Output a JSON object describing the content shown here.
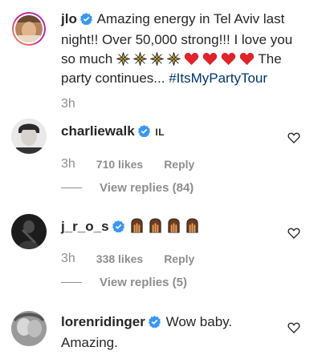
{
  "caption": {
    "username": "jlo",
    "text_line1": "Amazing energy in Tel Aviv last",
    "text_line2": "night!! Over 50,000 strong!!! I love you",
    "text_line3_prefix": "so much",
    "text_line3_suffix": "The",
    "text_line4": "party continues...",
    "hashtag": "#ItsMyPartyTour",
    "time": "3h",
    "emojis": [
      "sparkle-star",
      "sparkle-star",
      "sparkle-star",
      "sparkle-star",
      "red-heart",
      "red-heart",
      "red-heart",
      "red-heart"
    ]
  },
  "comments": [
    {
      "username": "charliewalk",
      "text": "IL",
      "time": "3h",
      "likes": "710 likes",
      "reply_label": "Reply",
      "view_replies": "View replies (84)"
    },
    {
      "username": "j_r_o_s",
      "text": "",
      "emojis": [
        "clapping-hands",
        "clapping-hands",
        "clapping-hands",
        "clapping-hands"
      ],
      "time": "3h",
      "likes": "338 likes",
      "reply_label": "Reply",
      "view_replies": "View replies (5)"
    },
    {
      "username": "lorenridinger",
      "text_line1": "Wow baby.",
      "text_line2": "Amazing."
    }
  ],
  "colors": {
    "verified_blue": "#3897f0",
    "hashtag": "#00376b",
    "muted": "#8e8e8e",
    "story_ring": "#d6249f"
  }
}
